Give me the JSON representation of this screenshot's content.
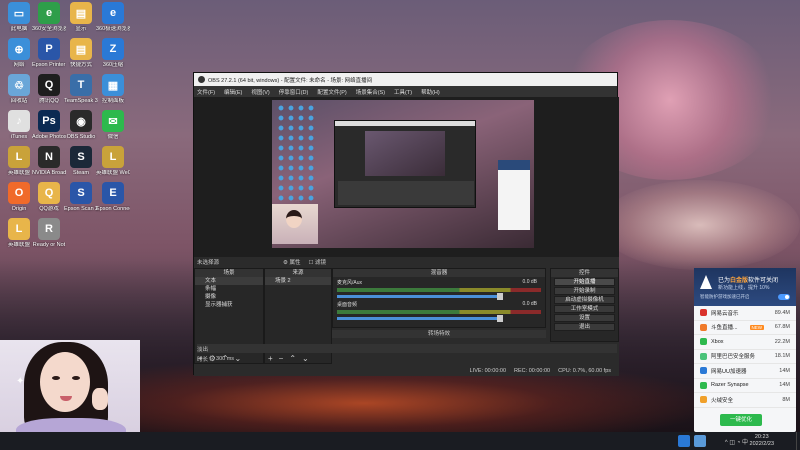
{
  "desktop": {
    "icons": [
      {
        "label": "此电脑",
        "color": "#3b8fd9",
        "glyph": "▭"
      },
      {
        "label": "360安全浏览器",
        "color": "#2e9e4a",
        "glyph": "e"
      },
      {
        "label": "显示",
        "color": "#e8b54a",
        "glyph": "▤"
      },
      {
        "label": "360极速浏览器X",
        "color": "#2a79d6",
        "glyph": "e"
      },
      {
        "label": "网络",
        "color": "#3b8fd9",
        "glyph": "⊕"
      },
      {
        "label": "Epson Printer C...",
        "color": "#2a56a8",
        "glyph": "P"
      },
      {
        "label": "快捷方式",
        "color": "#e8b54a",
        "glyph": "▤"
      },
      {
        "label": "360压缩",
        "color": "#2a79d6",
        "glyph": "Z"
      },
      {
        "label": "回收站",
        "color": "#6aa6d8",
        "glyph": "♲"
      },
      {
        "label": "腾讯QQ",
        "color": "#1e1e1e",
        "glyph": "Q"
      },
      {
        "label": "TeamSpeak 3",
        "color": "#3a6ea8",
        "glyph": "T"
      },
      {
        "label": "控制面板",
        "color": "#3b8fd9",
        "glyph": "▦"
      },
      {
        "label": "iTunes",
        "color": "#e0e0e0",
        "glyph": "♪"
      },
      {
        "label": "Adobe Photosh...",
        "color": "#0b2a52",
        "glyph": "Ps"
      },
      {
        "label": "OBS Studio",
        "color": "#2a2a2a",
        "glyph": "◉"
      },
      {
        "label": "微信",
        "color": "#2db94d",
        "glyph": "✉"
      },
      {
        "label": "英雄联盟",
        "color": "#c9a23a",
        "glyph": "L"
      },
      {
        "label": "NVIDIA Broadcast",
        "color": "#2a2a2a",
        "glyph": "N"
      },
      {
        "label": "Steam",
        "color": "#1b2838",
        "glyph": "S"
      },
      {
        "label": "英雄联盟 WeGame版",
        "color": "#c9a23a",
        "glyph": "L"
      },
      {
        "label": "Origin",
        "color": "#f06a2a",
        "glyph": "O"
      },
      {
        "label": "QQ游戏",
        "color": "#e8b54a",
        "glyph": "Q"
      },
      {
        "label": "Epson Scan 2",
        "color": "#2a56a8",
        "glyph": "S"
      },
      {
        "label": "Epson Connect Sc...",
        "color": "#2a56a8",
        "glyph": "E"
      },
      {
        "label": "英雄联盟",
        "color": "#e8b54a",
        "glyph": "L"
      },
      {
        "label": "Ready or Not",
        "color": "#8a8a8a",
        "glyph": "R"
      }
    ]
  },
  "obs": {
    "title": "OBS 27.2.1 (64 bit, windows) - 配置文件: 未命名 - 场景: 网络直播间",
    "controls": [
      "开始直播",
      "开始录制",
      "启动虚拟摄像机",
      "工作室模式",
      "设置",
      "退出"
    ],
    "menu": [
      "文件(F)",
      "编辑(E)",
      "视图(V)",
      "停靠窗口(D)",
      "配置文件(P)",
      "场景集合(S)",
      "工具(T)",
      "帮助(H)"
    ],
    "source_bar": {
      "label": "未选择源",
      "props": "⚙ 属性",
      "filters": "☐ 滤镜"
    },
    "docks": {
      "scenes_title": "场景",
      "sources_title": "来源",
      "mixer_title": "混音器",
      "controls_title": "控件"
    },
    "scenes": [
      "场景 2"
    ],
    "sources": [
      {
        "name": "文本"
      },
      {
        "name": "条幅"
      },
      {
        "name": "摄像"
      },
      {
        "name": "显示器捕获"
      }
    ],
    "mixer": [
      {
        "name": "麦克风/Aux",
        "db": "0.0 dB",
        "level": 0.6
      },
      {
        "name": "桌面音频",
        "db": "0.0 dB",
        "level": 0.55
      }
    ],
    "transitions_title": "转场特效",
    "transitions": {
      "type": "淡出",
      "duration_label": "时长",
      "duration_value": "300 ms"
    },
    "status": {
      "live": "LIVE: 00:00:00",
      "rec": "REC: 00:00:00",
      "cpu": "CPU: 0.7%, 60.00 fps"
    }
  },
  "cam": {
    "sparkle": "✦"
  },
  "popup": {
    "brand": "360",
    "title_prefix": "已为",
    "title_highlight": "白金版",
    "title_suffix": "软件可关闭",
    "subtitle": "新功能上线，提升 10%",
    "toggle_label": "智能防护游戏加速已开启",
    "apps": [
      {
        "name": "网易云音乐",
        "tag": "",
        "mem": "89.4M",
        "color": "#d9322c"
      },
      {
        "name": "斗鱼直播...",
        "tag": "NEW",
        "mem": "67.8M",
        "color": "#f07a2a"
      },
      {
        "name": "Xbox",
        "tag": "",
        "mem": "22.2M",
        "color": "#2db94d"
      },
      {
        "name": "阿里巴巴安全服务",
        "tag": "",
        "mem": "18.1M",
        "color": "#4ac37a"
      },
      {
        "name": "网易UU加速器",
        "tag": "",
        "mem": "14M",
        "color": "#2a79d6"
      },
      {
        "name": "Razer Synapse",
        "tag": "",
        "mem": "14M",
        "color": "#2db94d"
      },
      {
        "name": "火绒安全",
        "tag": "",
        "mem": "8M",
        "color": "#f0a02a"
      }
    ],
    "button": "一键优化"
  },
  "taskbar": {
    "tray_text": "^ ◫ ◔ 中",
    "time": "20:23",
    "date": "2022/2/23"
  }
}
